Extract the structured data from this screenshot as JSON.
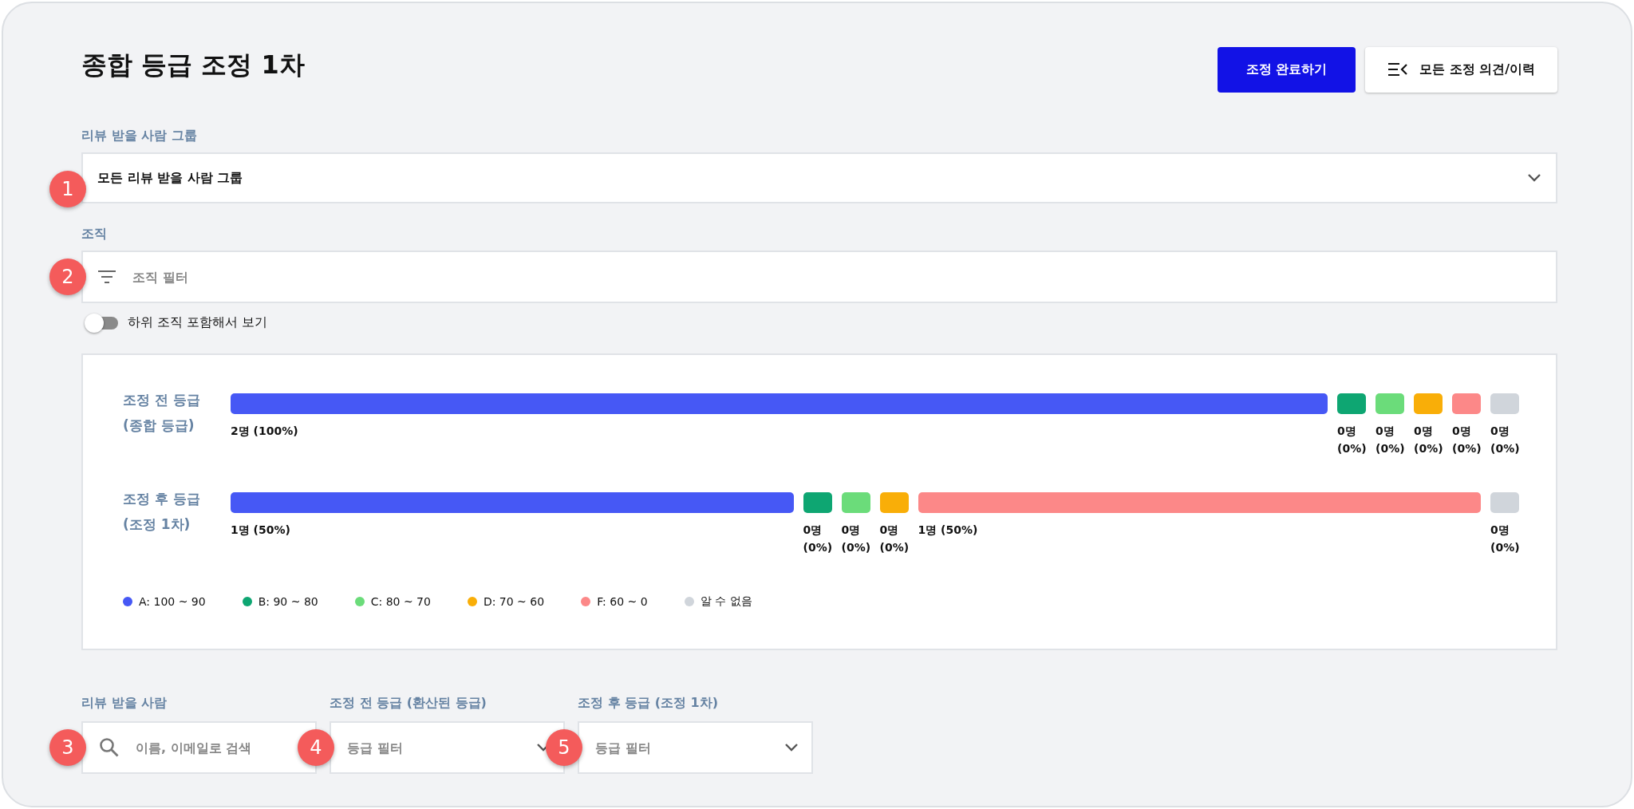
{
  "header": {
    "title": "종합 등급 조정 1차",
    "buttons": [
      {
        "label": "조정 완료하기",
        "kind": "primary"
      },
      {
        "label": "모든 조정 의견/이력",
        "kind": "history"
      }
    ]
  },
  "reviewee_group": {
    "step": "1",
    "label": "리뷰 받을 사람 그룹",
    "value": "모든 리뷰 받을 사람 그룹"
  },
  "organization": {
    "step": "2",
    "label": "조직",
    "placeholder": "조직 필터",
    "subtoggle": {
      "label": "하위 조직 포함해서 보기",
      "on": false
    }
  },
  "grade_distribution": {
    "rows": [
      {
        "title": "조정 전 등급",
        "subtitle": "(종합 등급)",
        "segments": [
          {
            "empty": false,
            "color": "#4658f5",
            "reading": "2명 (100%)"
          },
          {
            "empty": true,
            "color": "#0ea672",
            "reading": "0명 (0%)"
          },
          {
            "empty": true,
            "color": "#6bdc7a",
            "reading": "0명 (0%)"
          },
          {
            "empty": true,
            "color": "#f9ae08",
            "reading": "0명 (0%)"
          },
          {
            "empty": true,
            "color": "#fc8888",
            "reading": "0명 (0%)"
          },
          {
            "empty": true,
            "color": "#d0d5db",
            "reading": "0명 (0%)"
          }
        ]
      },
      {
        "title": "조정 후 등급",
        "subtitle": "(조정 1차)",
        "segments": [
          {
            "empty": false,
            "color": "#4658f5",
            "reading": "1명 (50%)"
          },
          {
            "empty": true,
            "color": "#0ea672",
            "reading": "0명 (0%)"
          },
          {
            "empty": true,
            "color": "#6bdc7a",
            "reading": "0명 (0%)"
          },
          {
            "empty": true,
            "color": "#f9ae08",
            "reading": "0명 (0%)"
          },
          {
            "empty": false,
            "color": "#fc8888",
            "reading": "1명 (50%)"
          },
          {
            "empty": true,
            "color": "#d0d5db",
            "reading": "0명 (0%)"
          }
        ]
      }
    ],
    "legend": [
      {
        "label": "A: 100 ~ 90",
        "color": "#4658f5"
      },
      {
        "label": "B: 90 ~ 80",
        "color": "#0ea672"
      },
      {
        "label": "C: 80 ~ 70",
        "color": "#6bdc7a"
      },
      {
        "label": "D: 70 ~ 60",
        "color": "#f9ae08"
      },
      {
        "label": "F: 60 ~ 0",
        "color": "#fc8888"
      },
      {
        "label": "알 수 없음",
        "color": "#d0d5db"
      }
    ]
  },
  "filters": [
    {
      "step": "3",
      "label": "리뷰 받을 사람",
      "placeholder": "이름, 이메일로 검색",
      "kind": "search"
    },
    {
      "step": "4",
      "label": "조정 전 등급 (환산된 등급)",
      "placeholder": "등급 필터",
      "kind": "select"
    },
    {
      "step": "5",
      "label": "조정 후 등급 (조정 1차)",
      "placeholder": "등급 필터",
      "kind": "select"
    }
  ]
}
